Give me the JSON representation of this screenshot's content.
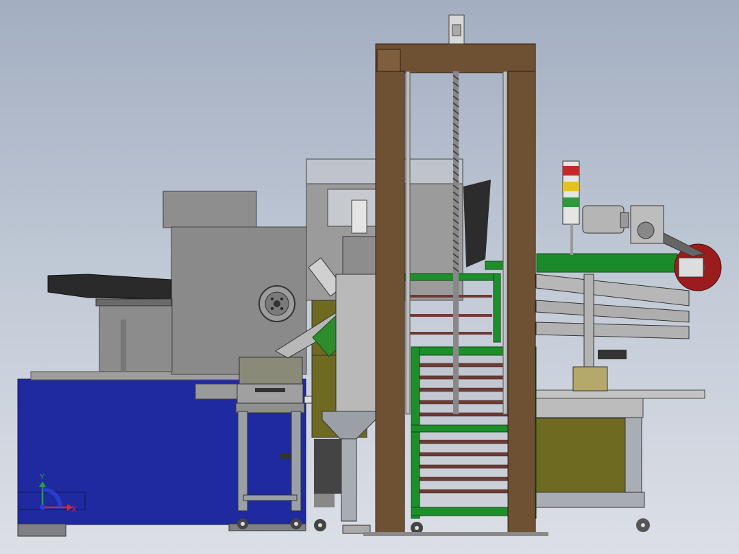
{
  "viewport": {
    "background_top": "#a3aec1",
    "background_bottom": "#dcdfe6"
  },
  "model": {
    "frame_color": "#6e5033",
    "base_color": "#1f2aa0",
    "rack_color": "#1c8f2a",
    "conveyor_color": "#1a8a2a",
    "housing_color": "#8c8c8c",
    "olive_panel_color": "#6e6a22",
    "pulley_color": "#9b1c1c"
  },
  "signal_tower": {
    "lights": [
      "red",
      "yellow",
      "green"
    ],
    "colors": [
      "#c62828",
      "#e2c21b",
      "#2e9a3a"
    ]
  },
  "triad": {
    "x_label": "X",
    "y_label": "Y",
    "x_color": "#d22b2b",
    "y_color": "#21a33a",
    "z_color": "#2b3fd6"
  }
}
